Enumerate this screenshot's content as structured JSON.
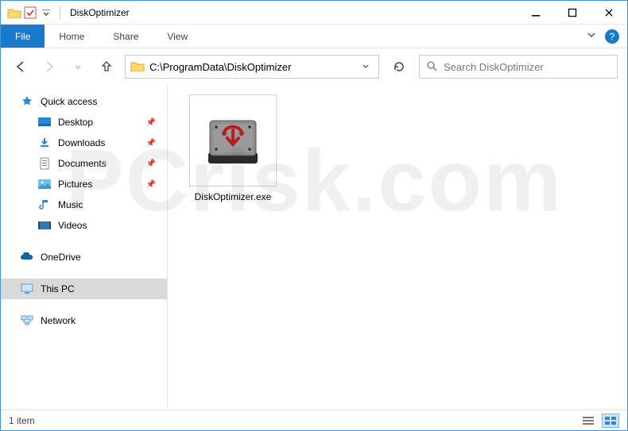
{
  "window": {
    "title": "DiskOptimizer"
  },
  "ribbon": {
    "file": "File",
    "tabs": [
      "Home",
      "Share",
      "View"
    ]
  },
  "nav": {
    "path": "C:\\ProgramData\\DiskOptimizer",
    "search_placeholder": "Search DiskOptimizer"
  },
  "sidebar": {
    "quick_access": "Quick access",
    "items": [
      {
        "label": "Desktop",
        "icon": "desktop",
        "pinned": true
      },
      {
        "label": "Downloads",
        "icon": "downloads",
        "pinned": true
      },
      {
        "label": "Documents",
        "icon": "documents",
        "pinned": true
      },
      {
        "label": "Pictures",
        "icon": "pictures",
        "pinned": true
      },
      {
        "label": "Music",
        "icon": "music",
        "pinned": false
      },
      {
        "label": "Videos",
        "icon": "videos",
        "pinned": false
      }
    ],
    "onedrive": "OneDrive",
    "thispc": "This PC",
    "network": "Network"
  },
  "content": {
    "files": [
      {
        "name": "DiskOptimizer.exe",
        "icon": "disk-drive"
      }
    ]
  },
  "status": {
    "text": "1 item"
  },
  "watermark": "PCrisk.com"
}
